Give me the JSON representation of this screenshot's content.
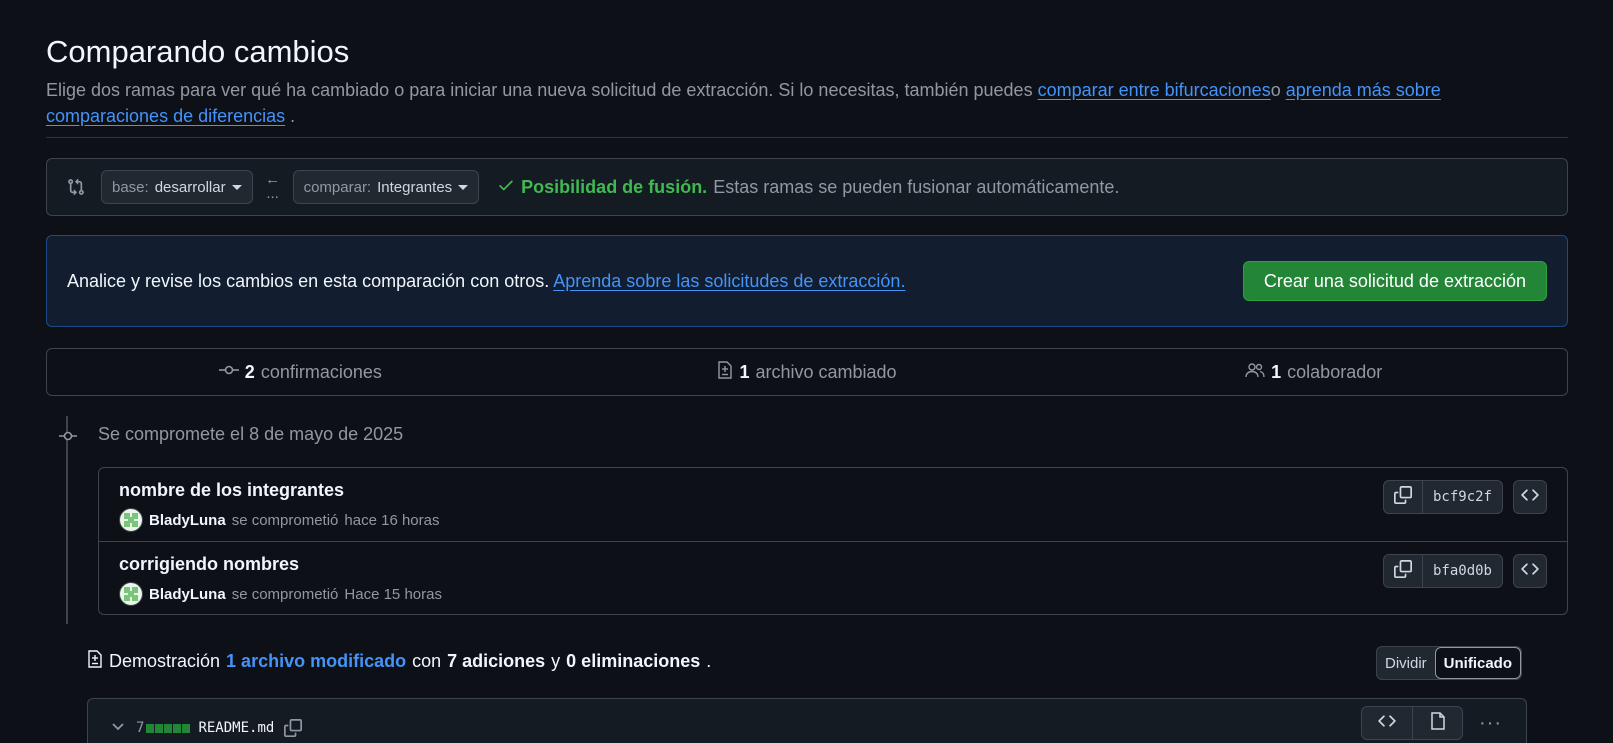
{
  "header": {
    "title": "Comparando cambios",
    "subtitle_prefix": "Elige dos ramas para ver qué ha cambiado o para iniciar una nueva solicitud de extracción. Si lo necesitas, también puedes ",
    "link_forks": "comparar entre bifurcaciones",
    "subtitle_mid": "o ",
    "link_learn": "aprenda más sobre comparaciones de diferencias",
    "subtitle_end": " ."
  },
  "range": {
    "base_key": "base:",
    "base_value": "desarrollar",
    "compare_key": "comparar:",
    "compare_value": "Integrantes",
    "arrow": "←",
    "ellipsis": "...",
    "merge_status": "Posibilidad de fusión.",
    "merge_detail": "Estas ramas se pueden fusionar automáticamente."
  },
  "banner": {
    "text": "Analice y revise los cambios en esta comparación con otros.",
    "link": "Aprenda sobre las solicitudes de extracción.",
    "button": "Crear una solicitud de extracción"
  },
  "stats": {
    "commits_count": "2",
    "commits_label": "confirmaciones",
    "files_count": "1",
    "files_label": "archivo cambiado",
    "contributors_count": "1",
    "contributors_label": "colaborador"
  },
  "commits": {
    "date_label": "Se compromete el 8 de mayo de 2025",
    "items": [
      {
        "message": "nombre de los integrantes",
        "author": "BladyLuna",
        "action": "se comprometió",
        "time": "hace 16 horas",
        "sha": "bcf9c2f"
      },
      {
        "message": "corrigiendo nombres",
        "author": "BladyLuna",
        "action": "se comprometió",
        "time": "Hace 15 horas",
        "sha": "bfa0d0b"
      }
    ]
  },
  "diff": {
    "prefix": "Demostración",
    "files_link": "1 archivo modificado",
    "with": "con",
    "additions": "7 adiciones",
    "and": "y",
    "deletions": "0 eliminaciones",
    "end": ".",
    "view_split": "Dividir",
    "view_unified": "Unificado"
  },
  "file": {
    "changes": "7",
    "name": "README.md",
    "ellipsis": "···"
  },
  "colors": {
    "background": "#0d1117",
    "accent": "#4493f8",
    "success": "#3fb950",
    "primary_button": "#238636"
  }
}
